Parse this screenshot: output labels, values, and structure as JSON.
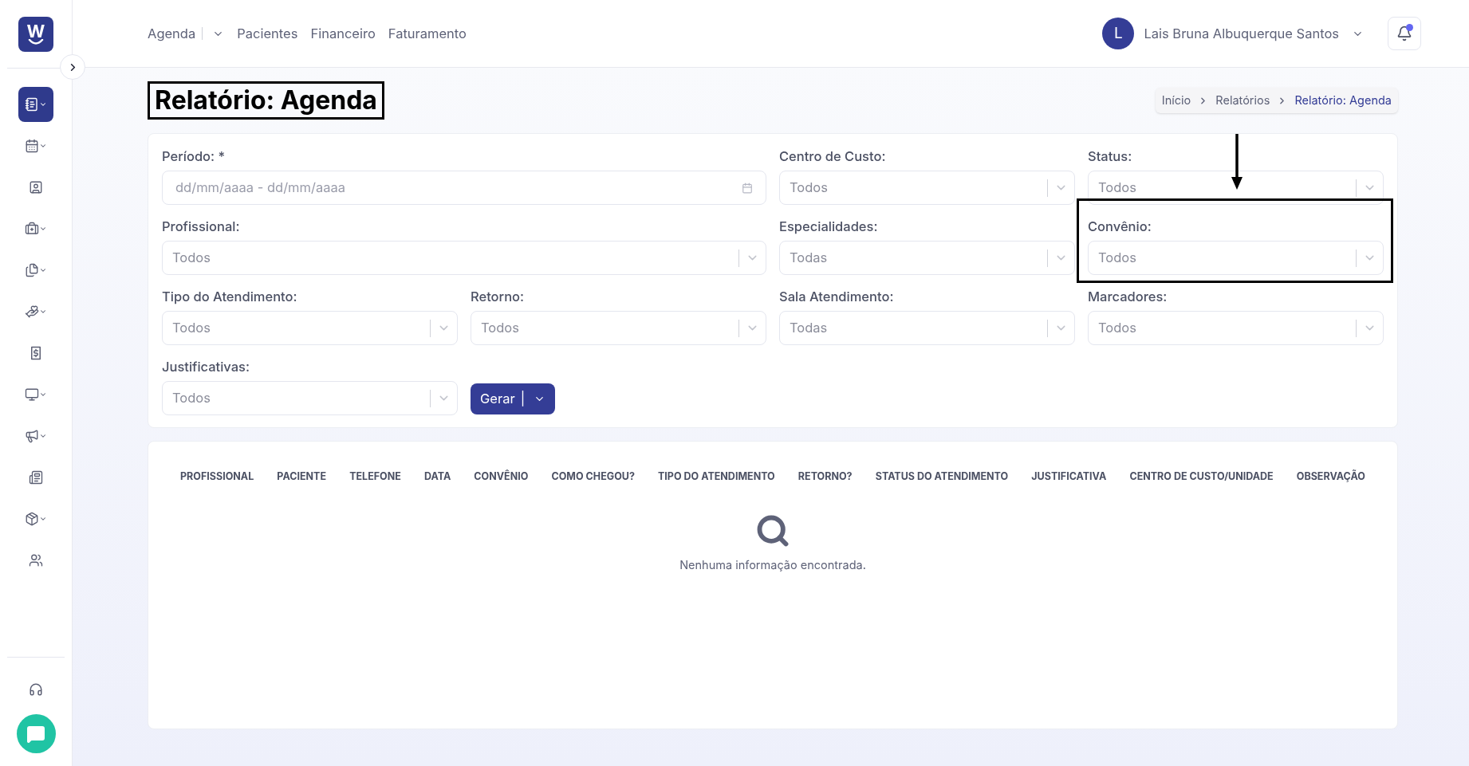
{
  "sidebar": {
    "logo": "W",
    "items": [
      {
        "kind": "notebook",
        "selected": true,
        "submenu": true
      },
      {
        "kind": "calendar",
        "selected": false,
        "submenu": true
      },
      {
        "kind": "contact",
        "selected": false,
        "submenu": false
      },
      {
        "kind": "medical",
        "selected": false,
        "submenu": true
      },
      {
        "kind": "files",
        "selected": false,
        "submenu": true
      },
      {
        "kind": "hand-heart",
        "selected": false,
        "submenu": true
      },
      {
        "kind": "receipt",
        "selected": false,
        "submenu": false
      },
      {
        "kind": "monitor",
        "selected": false,
        "submenu": true
      },
      {
        "kind": "megaphone",
        "selected": false,
        "submenu": true
      },
      {
        "kind": "newspaper",
        "selected": false,
        "submenu": false
      },
      {
        "kind": "package",
        "selected": false,
        "submenu": true
      },
      {
        "kind": "users",
        "selected": false,
        "submenu": false
      }
    ],
    "bottom": [
      {
        "kind": "headset"
      }
    ]
  },
  "top_nav": [
    {
      "label": "Agenda",
      "dropdown": true
    },
    {
      "label": "Pacientes"
    },
    {
      "label": "Financeiro"
    },
    {
      "label": "Faturamento"
    }
  ],
  "user": {
    "initial": "L",
    "name": "Lais Bruna Albuquerque Santos",
    "unread_notifications": true
  },
  "page_title": {
    "text": "Relatório: Agenda",
    "outlined": true
  },
  "breadcrumb": [
    {
      "label": "Início",
      "current": false
    },
    {
      "label": "Relatórios",
      "current": false
    },
    {
      "label": "Relatório: Agenda",
      "current": true
    }
  ],
  "filters": [
    {
      "kind": "date-range",
      "label": "Período: *",
      "placeholder": "dd/mm/aaaa - dd/mm/aaaa"
    },
    {
      "kind": "select",
      "label": "Centro de Custo:",
      "placeholder": "Todos"
    },
    {
      "kind": "select",
      "label": "Status:",
      "placeholder": "Todos"
    },
    {
      "kind": "select",
      "label": "Profissional:",
      "placeholder": "Todos"
    },
    {
      "kind": "select",
      "label": "Especialidades:",
      "placeholder": "Todas"
    },
    {
      "kind": "select",
      "label": "Convênio:",
      "placeholder": "Todos",
      "outlined": true,
      "arrow": true
    },
    {
      "kind": "select",
      "label": "Tipo do Atendimento:",
      "placeholder": "Todos"
    },
    {
      "kind": "select",
      "label": "Retorno:",
      "placeholder": "Todos"
    },
    {
      "kind": "select",
      "label": "Sala Atendimento:",
      "placeholder": "Todas"
    },
    {
      "kind": "select",
      "label": "Marcadores:",
      "placeholder": "Todos"
    },
    {
      "kind": "select",
      "label": "Justificativas:",
      "placeholder": "Todos"
    }
  ],
  "generate_button": {
    "label": "Gerar",
    "separator": "|"
  },
  "table": {
    "columns": [
      "PROFISSIONAL",
      "PACIENTE",
      "TELEFONE",
      "DATA",
      "CONVÊNIO",
      "COMO CHEGOU?",
      "TIPO DO ATENDIMENTO",
      "RETORNO?",
      "STATUS DO ATENDIMENTO",
      "JUSTIFICATIVA",
      "CENTRO DE CUSTO/UNIDADE",
      "OBSERVAÇÃO"
    ],
    "empty_message": "Nenhuma informação encontrada."
  }
}
